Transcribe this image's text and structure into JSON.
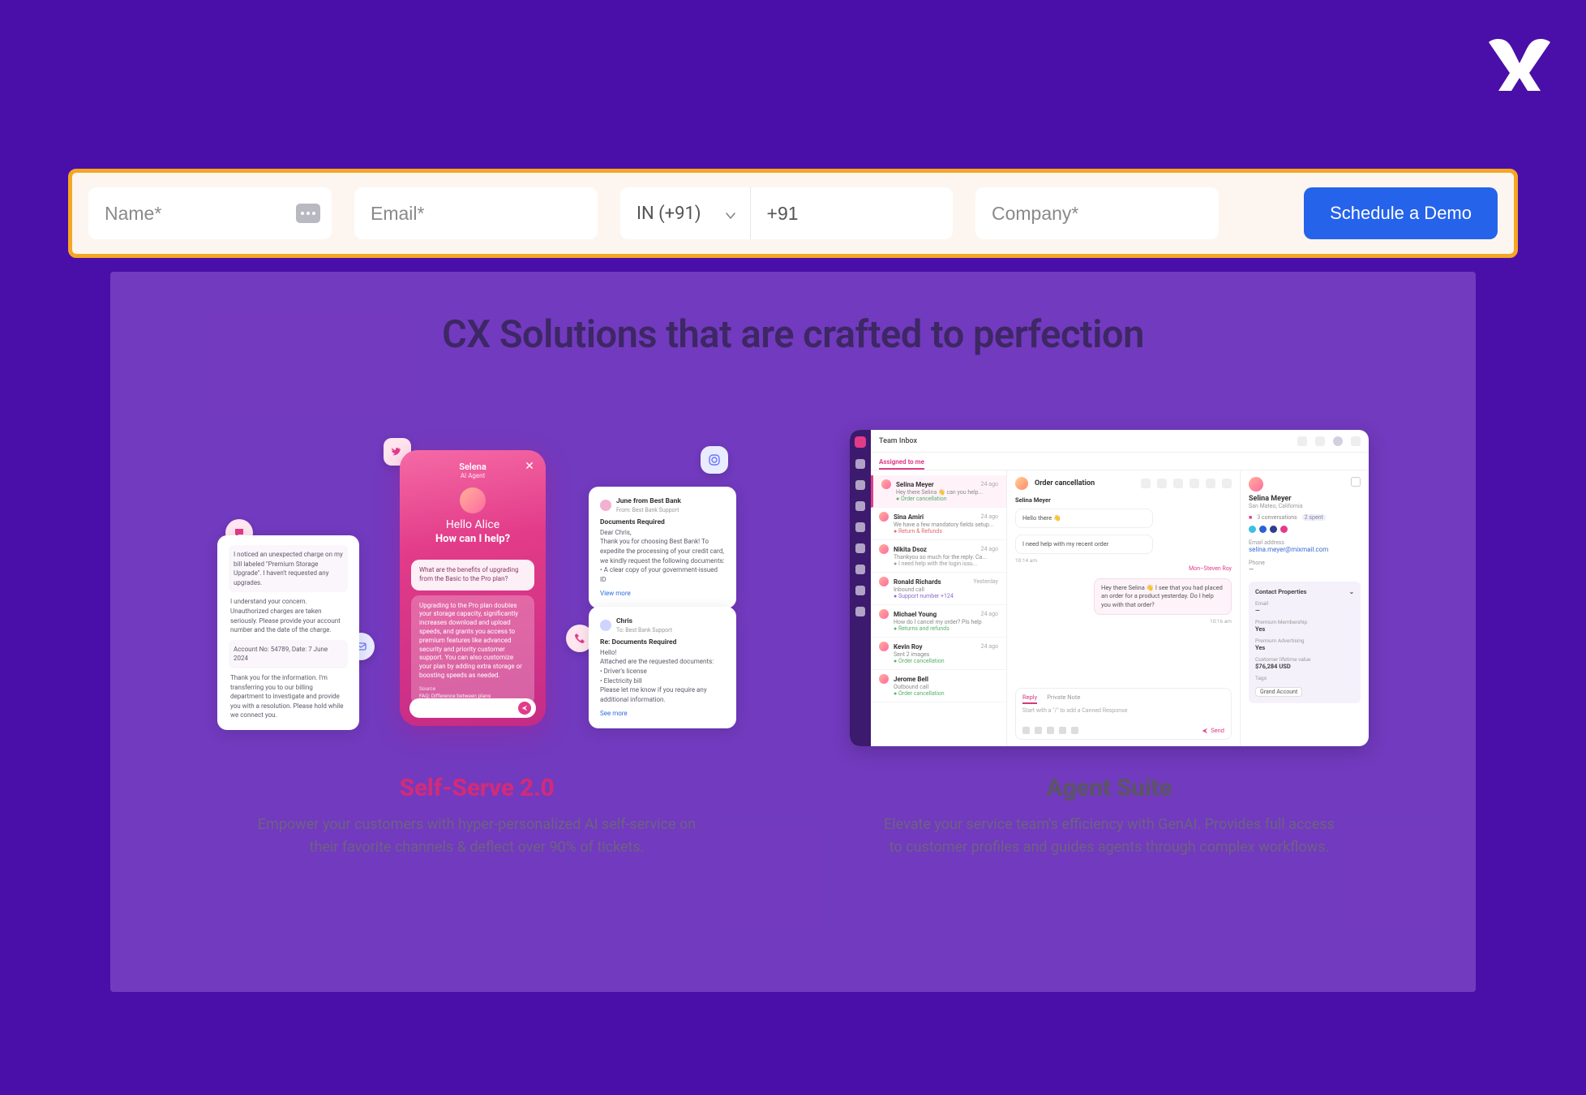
{
  "logo": {
    "name": "brand-x-logo"
  },
  "form": {
    "name_placeholder": "Name*",
    "email_placeholder": "Email*",
    "country_code_label": "IN (+91)",
    "phone_value": "+91",
    "company_placeholder": "Company*",
    "cta_label": "Schedule a Demo"
  },
  "section": {
    "title": "CX Solutions that are crafted to perfection"
  },
  "self_serve": {
    "title": "Self-Serve 2.0",
    "desc": "Empower your customers with hyper-personalized AI self-service on their favorite channels & deflect over 90% of tickets.",
    "phone": {
      "agent_name": "Selena",
      "agent_role": "AI Agent",
      "greeting": "Hello Alice",
      "help": "How can I help?",
      "assistant_msg": "What are the benefits of upgrading from the Basic to the Pro plan?",
      "user_msg": "Upgrading to the Pro plan doubles your storage capacity, significantly increases download and upload speeds, and grants you access to premium features like advanced security and priority customer support. You can also customize your plan by adding extra storage or boosting speeds as needed.",
      "foot1": "Source",
      "foot2": "FAQ: Difference between plans"
    },
    "left_card": {
      "l1": "I noticed an unexpected charge on my bill labeled \"Premium Storage Upgrade\". I haven't requested any upgrades.",
      "l2": "I understand your concern. Unauthorized charges are taken seriously. Please provide your account number and the date of the charge.",
      "l3": "Account No: 54789, Date: 7 June 2024",
      "l4": "Thank you for the information. I'm transferring you to our billing department to investigate and provide you with a resolution. Please hold while we connect you."
    },
    "mail1": {
      "name": "June from Best Bank",
      "from": "From: Best Bank Support",
      "title": "Documents Required",
      "greet": "Dear Chris,",
      "body": "Thank you for choosing Best Bank! To expedite the processing of your credit card, we kindly request the following documents:",
      "bullet": "• A clear copy of your government-issued ID",
      "link": "View more"
    },
    "mail2": {
      "name": "Chris",
      "to": "To: Best Bank Support",
      "title": "Re: Documents Required",
      "greet": "Hello!",
      "body": "Attached are the requested documents:",
      "b1": "• Driver's license",
      "b2": "• Electricity bill",
      "foot": "Please let me know if you require any additional information.",
      "link": "See more"
    }
  },
  "agent_suite": {
    "title": "Agent Suite",
    "desc": "Elevate your service team's efficiency with GenAI. Provides full access to customer profiles and guides agents through complex workflows.",
    "topbar_title": "Team Inbox",
    "tab_active": "Assigned to me",
    "list": [
      {
        "name": "Selina Meyer",
        "snippet": "Hey there Selina 👋 can you help...",
        "time": "24 ago",
        "tag": "Order cancellation",
        "tag_class": "tg"
      },
      {
        "name": "Sina Amiri",
        "snippet": "We have a few mandatory fields setup...",
        "time": "24 ago",
        "tag": "Return & Refunds",
        "tag_class": "tg red"
      },
      {
        "name": "Nikita Dsoz",
        "snippet": "Thankyou so much for the reply. Ca...",
        "time": "24 ago",
        "tag": "I need help with the login issu...",
        "tag_class": "tg gray"
      },
      {
        "name": "Ronald Richards",
        "snippet": "Inbound call",
        "time": "Yesterday",
        "tag": "Support number +124",
        "tag_class": "tg purple"
      },
      {
        "name": "Michael Young",
        "snippet": "How do I cancel my order? Pls help",
        "time": "24 ago",
        "tag": "Returns and refunds",
        "tag_class": "tg"
      },
      {
        "name": "Kevin Roy",
        "snippet": "Sent 2 images",
        "time": "24 ago",
        "tag": "Order cancellation",
        "tag_class": "tg"
      },
      {
        "name": "Jerome Bell",
        "snippet": "Outbound call",
        "time": "",
        "tag": "Order cancellation",
        "tag_class": "tg"
      }
    ],
    "convo": {
      "title": "Order cancellation",
      "msg1_name": "Selina Meyer",
      "msg1": "Hello there 👋",
      "msg2": "I need help with my recent order",
      "time1": "10:14 am",
      "note": "Mon–Steven Roy",
      "reply": "Hey there Selina 👋 I see that you had placed an order for a product yesterday. Do I help you with that order?",
      "time2": "10:16 am",
      "tab_reply": "Reply",
      "tab_note": "Private Note",
      "compose_hint": "Start with a \"/\" to add a Canned Response",
      "send": "Send"
    },
    "side": {
      "name": "Selina Meyer",
      "loc": "San Mateo, California",
      "convs": "3 conversations",
      "spent": "2 spent",
      "label_email": "Email address",
      "email": "selina.meyer@mixmail.com",
      "label_phone": "Phone",
      "phone": "—",
      "panel_title": "Contact Properties",
      "k1": "Email",
      "v1": "—",
      "k2": "Premium Membership",
      "v2": "Yes",
      "k3": "Premium Advertising",
      "v3": "Yes",
      "k4": "Customer lifetime value",
      "v4": "$76,284 USD",
      "k5": "Tags",
      "chip": "Grand Account"
    }
  }
}
